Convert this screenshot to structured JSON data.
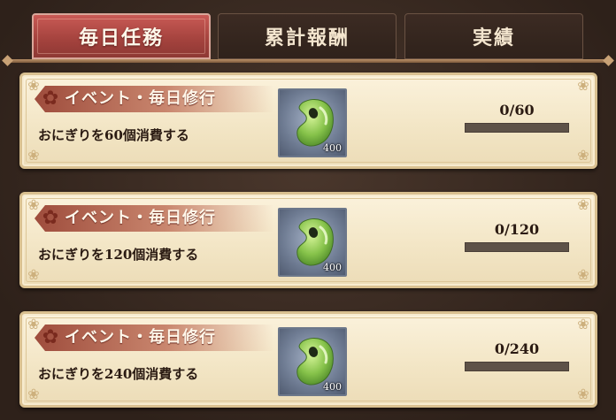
{
  "tabs": [
    {
      "label": "毎日任務",
      "active": true
    },
    {
      "label": "累計報酬",
      "active": false
    },
    {
      "label": "実績",
      "active": false
    }
  ],
  "missions": [
    {
      "category": "イベント・毎日修行",
      "description": "おにぎりを60個消費する",
      "reward_icon": "green-bean-icon",
      "reward_count": "400",
      "progress_label": "0/60",
      "progress_fraction": 0
    },
    {
      "category": "イベント・毎日修行",
      "description": "おにぎりを120個消費する",
      "reward_icon": "green-bean-icon",
      "reward_count": "400",
      "progress_label": "0/120",
      "progress_fraction": 0
    },
    {
      "category": "イベント・毎日修行",
      "description": "おにぎりを240個消費する",
      "reward_icon": "green-bean-icon",
      "reward_count": "400",
      "progress_label": "0/240",
      "progress_fraction": 0
    }
  ],
  "colors": {
    "active_tab": "#a3423d",
    "card_bg": "#f3e6c6",
    "banner": "#b56a55",
    "progress_track": "#5e5248"
  }
}
